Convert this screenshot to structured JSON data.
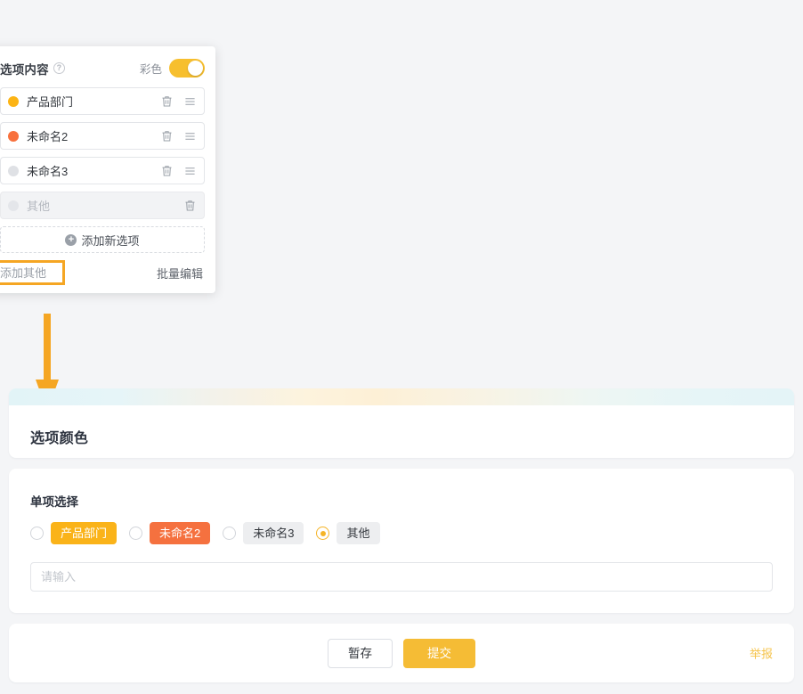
{
  "editor_panel": {
    "title": "选项内容",
    "help_icon": "question-circle-icon",
    "color_toggle_label": "彩色",
    "color_toggle_on": true,
    "options": [
      {
        "label": "产品部门",
        "color": "#FCB415",
        "disabled": false,
        "has_drag": true,
        "has_delete": true
      },
      {
        "label": "未命名2",
        "color": "#F8713D",
        "disabled": false,
        "has_drag": true,
        "has_delete": true
      },
      {
        "label": "未命名3",
        "color": "#DFE1E5",
        "disabled": false,
        "has_drag": true,
        "has_delete": true
      },
      {
        "label": "其他",
        "color": "#E4E6EA",
        "disabled": true,
        "has_drag": false,
        "has_delete": true
      }
    ],
    "add_option_label": "添加新选项",
    "add_option_icon": "plus-circle-icon",
    "add_other_label": "添加其他",
    "batch_edit_label": "批量编辑"
  },
  "annotation": {
    "highlight_target": "添加其他",
    "highlight_color": "#F5A623",
    "arrow_color": "#F5A623",
    "arrow_direction": "down"
  },
  "form": {
    "header_title": "选项颜色",
    "question_label": "单项选择",
    "choices": [
      {
        "label": "产品部门",
        "selected": false,
        "bg": "#FAB319",
        "fg": "#FFFFFF"
      },
      {
        "label": "未命名2",
        "selected": false,
        "bg": "#F5713F",
        "fg": "#FFFFFF"
      },
      {
        "label": "未命名3",
        "selected": false,
        "bg": "#EDEEF0",
        "fg": "#33373D"
      },
      {
        "label": "其他",
        "selected": true,
        "bg": "#EDEEF0",
        "fg": "#33373D"
      }
    ],
    "text_input_value": "",
    "text_input_placeholder": "请输入",
    "save_draft_label": "暂存",
    "submit_label": "提交",
    "report_label": "举报",
    "accent_color": "#F5BC35"
  }
}
